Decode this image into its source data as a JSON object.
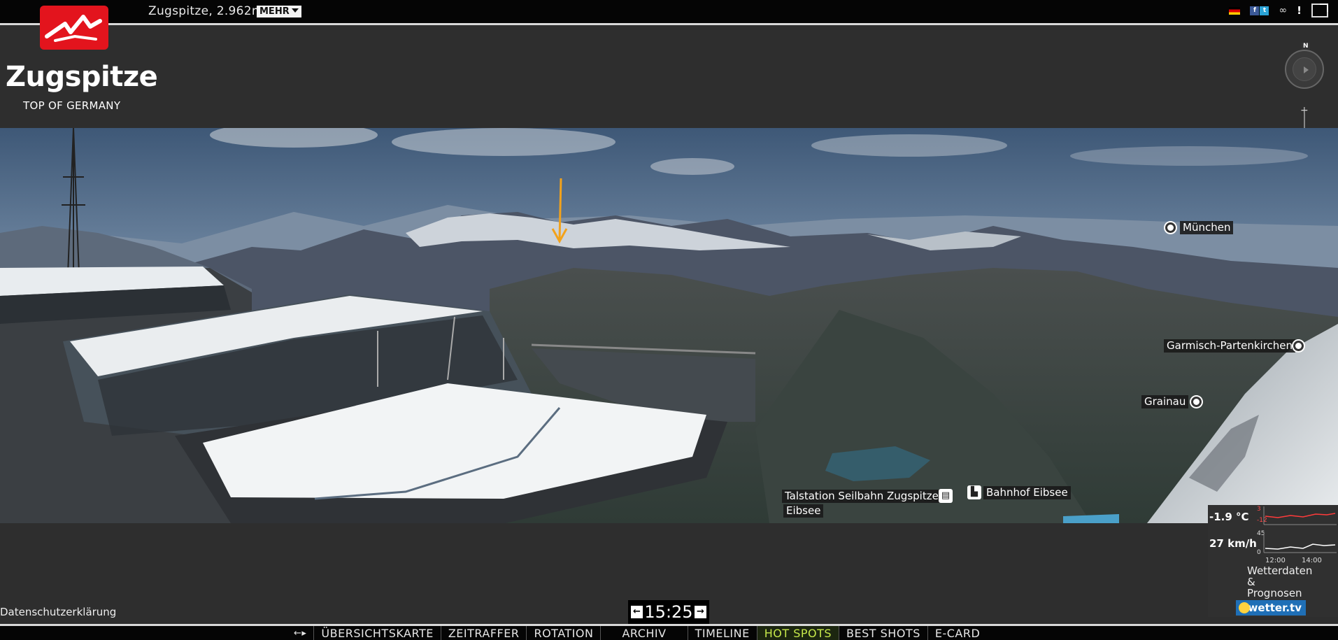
{
  "header": {
    "location": "Zugspitze, 2.962m",
    "more_label": "MEHR"
  },
  "logo": {
    "title": "Zugspitze",
    "subtitle": "TOP OF GERMANY",
    "brand_color": "#e3141d"
  },
  "top_icons": [
    "german-flag-icon",
    "facebook-icon",
    "twitter-icon",
    "infinity-icon",
    "info-exclamation-icon",
    "fullscreen-icon"
  ],
  "compass": {
    "north_label": "N"
  },
  "zoom": {
    "plus": "+",
    "minus": "−"
  },
  "panorama": {
    "labels": {
      "muenchen": "München",
      "garmisch": "Garmisch-Partenkirchen",
      "grainau": "Grainau",
      "talstation": "Talstation Seilbahn Zugspitze",
      "eibsee": "Eibsee",
      "bahnhof": "Bahnhof Eibsee"
    },
    "highlight_arrow_color": "#f2a21b"
  },
  "weather": {
    "temperature": "-1.9 °C",
    "wind": "27 km/h",
    "temp_scale_top": "3",
    "temp_scale_bottom": "-12",
    "wind_scale_top": "45",
    "wind_scale_bottom": "0",
    "time_1": "12:00",
    "time_2": "14:00",
    "data_line1": "Wetterdaten",
    "data_line2": "&",
    "data_line3": "Prognosen",
    "provider": "wetter.tv"
  },
  "footer": {
    "privacy": "Datenschutzerklärung",
    "time": "15:25",
    "prev": "←",
    "next": "→"
  },
  "nav": {
    "swap": "←▸",
    "items": [
      "ÜBERSICHTSKARTE",
      "ZEITRAFFER",
      "ROTATION",
      "ARCHIV",
      "TIMELINE",
      "HOT SPOTS",
      "BEST SHOTS",
      "E-CARD"
    ],
    "active": "HOT SPOTS",
    "active_color": "#c6e84a"
  }
}
